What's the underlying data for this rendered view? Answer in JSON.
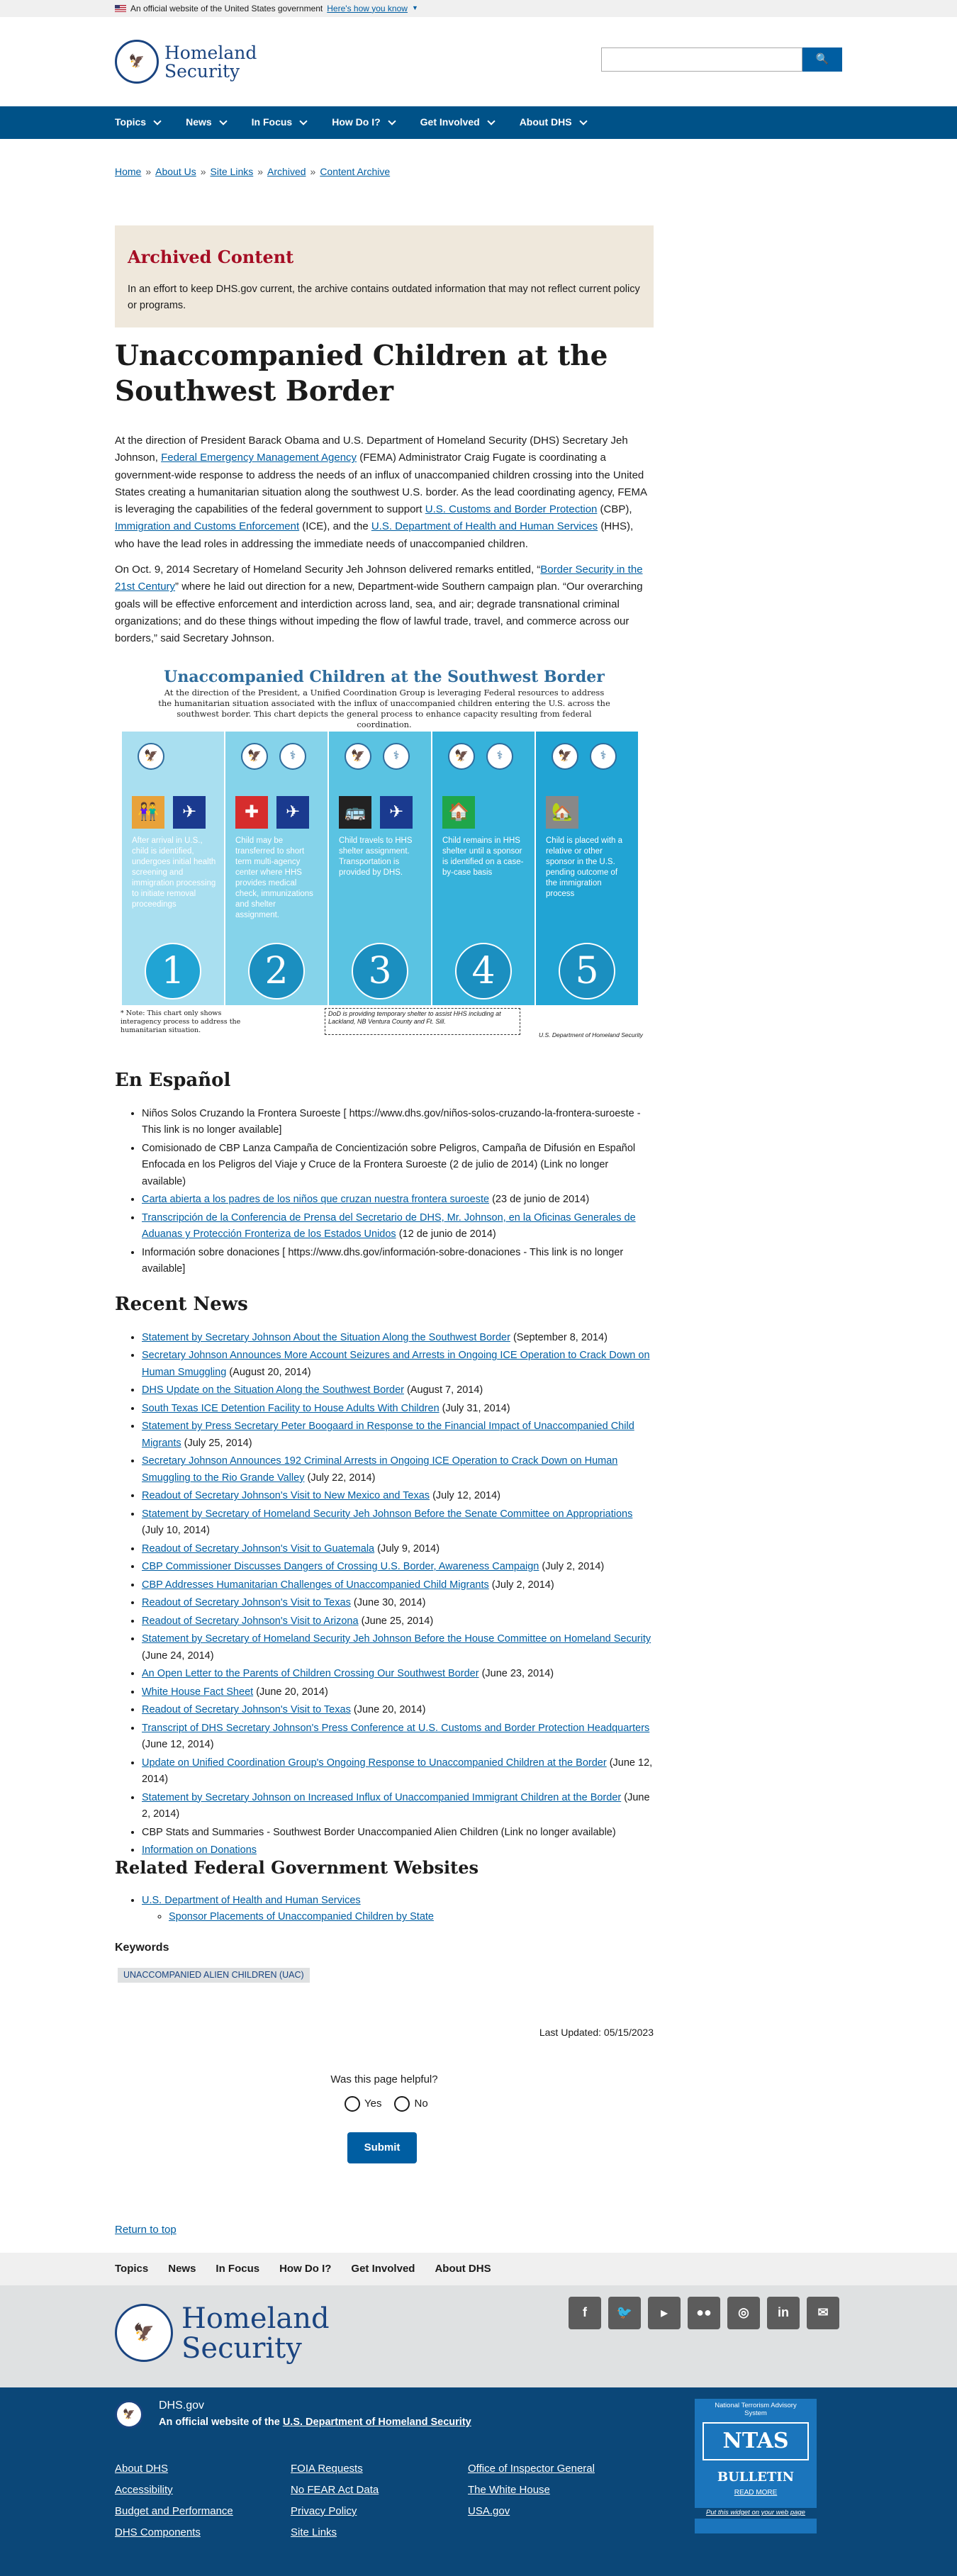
{
  "banner": {
    "text": "An official website of the United States government",
    "link": "Here's how you know"
  },
  "header": {
    "logo_line1": "Homeland",
    "logo_line2": "Security",
    "search_placeholder": "",
    "search_icon": "search-icon"
  },
  "nav": {
    "items": [
      "Topics",
      "News",
      "In Focus",
      "How Do I?",
      "Get Involved",
      "About DHS"
    ]
  },
  "breadcrumbs": [
    "Home",
    "About Us",
    "Site Links",
    "Archived",
    "Content Archive"
  ],
  "archived": {
    "title": "Archived Content",
    "text": "In an effort to keep DHS.gov current, the archive contains outdated information that may not reflect current policy or programs."
  },
  "page_title": "Unaccompanied Children at the Southwest Border",
  "intro": {
    "p1_a": "At the direction of President Barack Obama and U.S. Department of Homeland Security (DHS) Secretary Jeh Johnson,",
    "p1_link1": "Federal Emergency Management Agency",
    "p1_b": "(FEMA) Administrator Craig Fugate is coordinating a government-wide response to address the needs of an influx of unaccompanied children crossing into the United States creating a humanitarian situation along the southwest U.S. border. As the lead coordinating agency, FEMA is leveraging the capabilities of the federal government to support",
    "p1_link2": "U.S. Customs and Border Protection",
    "p1_c": "(CBP),",
    "p1_link3": "Immigration and Customs Enforcement",
    "p1_d": "(ICE), and the",
    "p1_link4": "U.S. Department of Health and Human Services",
    "p1_e": "(HHS), who have the lead roles in addressing the immediate needs of unaccompanied children.",
    "p2_a": "On Oct. 9, 2014 Secretary of Homeland Security Jeh Johnson delivered remarks entitled, “",
    "p2_link": "Border Security in the 21st Century",
    "p2_b": "” where he laid out direction for a new, Department-wide Southern campaign plan. “Our overarching goals will be effective enforcement and interdiction across land, sea, and air; degrade transnational criminal organizations; and do these things without impeding the flow of lawful trade, travel, and commerce across our borders,” said Secretary Johnson."
  },
  "infographic": {
    "title": "Unaccompanied Children at the Southwest Border",
    "subtitle": "At the direction of the President, a Unified Coordination Group is leveraging Federal resources to address the humanitarian situation associated with the influx of unaccompanied children entering the U.S. across the southwest border. This chart depicts the general process to enhance capacity resulting from federal coordination.",
    "steps": [
      {
        "num": "1",
        "text": "After arrival in U.S., child is identified, undergoes initial health screening and immigration processing to initiate removal proceedings",
        "color": "#a9dff0"
      },
      {
        "num": "2",
        "text": "Child may be transferred to short term multi-agency center where HHS provides medical check, immunizations and shelter assignment.",
        "color": "#85d3ea"
      },
      {
        "num": "3",
        "text": "Child travels to HHS shelter assignment. Transportation is provided by DHS.",
        "color": "#5ac3e2"
      },
      {
        "num": "4",
        "text": "Child remains in HHS shelter until a sponsor is identified on a case-by-case basis",
        "color": "#36b2db"
      },
      {
        "num": "5",
        "text": "Child is placed with a relative or other sponsor in the U.S. pending outcome of the immigration process",
        "color": "#21a4d4"
      }
    ],
    "note": "* Note: This chart only shows interagency process to address the humanitarian situation.",
    "dod_note": "DoD is providing temporary shelter to assist HHS including at Lackland, NB Ventura County and Ft. Sill.",
    "credit": "U.S. Department of Homeland Security"
  },
  "espanol": {
    "heading": "En Español",
    "items": [
      {
        "text": "Niños Solos Cruzando la Frontera Suroeste [ https://www.dhs.gov/niños-solos-cruzando-la-frontera-suroeste - This link is no longer available]",
        "link": false
      },
      {
        "text": "Comisionado de CBP Lanza Campaña de Concientización sobre Peligros, Campaña de Difusión en Español Enfocada en los Peligros del Viaje y Cruce de la Frontera Suroeste (2 de julio de 2014) (Link no longer available)",
        "link": false
      },
      {
        "link_text": "Carta abierta a los padres de los niños que cruzan nuestra frontera suroeste",
        "tail": "(23 de junio de 2014)",
        "link": true
      },
      {
        "link_text": "Transcripción de la Conferencia de Prensa del Secretario de DHS, Mr. Johnson, en la Oficinas Generales de Aduanas y Protección Fronteriza de los Estados Unidos",
        "tail": "(12 de junio de 2014)",
        "link": true
      },
      {
        "text": "Información sobre donaciones [ https://www.dhs.gov/información-sobre-donaciones - This link is no longer available]",
        "link": false
      }
    ]
  },
  "news": {
    "heading": "Recent News",
    "items": [
      {
        "link_text": "Statement by Secretary Johnson About the Situation Along the Southwest Border",
        "tail": "(September 8, 2014)"
      },
      {
        "link_text": "Secretary Johnson Announces More Account Seizures and Arrests in Ongoing ICE Operation to Crack Down on Human Smuggling",
        "tail": "(August 20, 2014)"
      },
      {
        "link_text": "DHS Update on the Situation Along the Southwest Border",
        "tail": "(August 7, 2014)"
      },
      {
        "link_text": "South Texas ICE Detention Facility to House Adults With Children",
        "tail": "(July 31, 2014)"
      },
      {
        "link_text": "Statement by Press Secretary Peter Boogaard in Response to the Financial Impact of Unaccompanied Child Migrants",
        "tail": "(July 25, 2014)"
      },
      {
        "link_text": "Secretary Johnson Announces 192 Criminal Arrests in Ongoing ICE Operation to Crack Down on Human Smuggling to the Rio Grande Valley",
        "tail": "(July 22, 2014)"
      },
      {
        "link_text": "Readout of Secretary Johnson's Visit to New Mexico and Texas",
        "tail": "(July 12, 2014)"
      },
      {
        "link_text": "Statement by Secretary of Homeland Security Jeh Johnson Before the Senate Committee on Appropriations",
        "tail": "(July 10, 2014)"
      },
      {
        "link_text": "Readout of Secretary Johnson's Visit to Guatemala",
        "tail": "(July 9, 2014)"
      },
      {
        "link_text": "CBP Commissioner Discusses Dangers of Crossing U.S. Border, Awareness Campaign",
        "tail": "(July 2, 2014)"
      },
      {
        "link_text": "CBP Addresses Humanitarian Challenges of Unaccompanied Child Migrants",
        "tail": "(July 2, 2014)"
      },
      {
        "link_text": "Readout of Secretary Johnson's Visit to Texas",
        "tail": "(June 30, 2014)"
      },
      {
        "link_text": "Readout of Secretary Johnson's Visit to Arizona",
        "tail": "(June 25, 2014)"
      },
      {
        "link_text": "Statement by Secretary of Homeland Security Jeh Johnson Before the House Committee on Homeland Security",
        "tail": "(June 24, 2014)"
      },
      {
        "link_text": "An Open Letter to the Parents of Children Crossing Our Southwest Border",
        "tail": "(June 23, 2014)"
      },
      {
        "link_text": "White House Fact Sheet",
        "tail": "(June 20, 2014)"
      },
      {
        "link_text": "Readout of Secretary Johnson's Visit to Texas",
        "tail": "(June 20, 2014)"
      },
      {
        "link_text": "Transcript of DHS Secretary Johnson's Press Conference at U.S. Customs and Border Protection Headquarters",
        "tail": "(June 12, 2014)"
      },
      {
        "link_text": "Update on Unified Coordination Group's Ongoing Response to Unaccompanied Children at the Border",
        "tail": "(June 12, 2014)"
      },
      {
        "link_text": "Statement by Secretary Johnson on Increased Influx of Unaccompanied Immigrant Children at the Border",
        "tail": "(June 2, 2014)"
      },
      {
        "plain": "CBP Stats and Summaries - Southwest Border Unaccompanied Alien Children (Link no longer available)"
      },
      {
        "link_text": "Information on Donations",
        "tail": ""
      }
    ]
  },
  "related": {
    "heading": "Related Federal Government Websites",
    "item": "U.S. Department of Health and Human Services",
    "subitem": "Sponsor Placements of Unaccompanied Children by State"
  },
  "keywords": {
    "heading": "Keywords",
    "tag": "UNACCOMPANIED ALIEN CHILDREN (UAC)"
  },
  "updated": "Last Updated: 05/15/2023",
  "feedback": {
    "question": "Was this page helpful?",
    "yes": "Yes",
    "no": "No",
    "submit": "Submit"
  },
  "return_top": "Return to top",
  "footer_nav": [
    "Topics",
    "News",
    "In Focus",
    "How Do I?",
    "Get Involved",
    "About DHS"
  ],
  "social_icons": [
    "facebook-icon",
    "twitter-icon",
    "youtube-icon",
    "flickr-icon",
    "instagram-icon",
    "linkedin-icon",
    "email-icon"
  ],
  "footer": {
    "site": "DHS.gov",
    "official_a": "An official website of the",
    "official_link": "U.S. Department of Homeland Security",
    "col1": [
      "About DHS",
      "Accessibility",
      "Budget and Performance",
      "DHS Components"
    ],
    "col2": [
      "FOIA Requests",
      "No FEAR Act Data",
      "Privacy Policy",
      "Site Links"
    ],
    "col3": [
      "Office of Inspector General",
      "The White House",
      "USA.gov"
    ],
    "ntas": {
      "top": "National Terrorism Advisory System",
      "name": "NTAS",
      "bulletin": "BULLETIN",
      "read": "READ MORE",
      "widget": "Put this widget on your web page"
    }
  }
}
